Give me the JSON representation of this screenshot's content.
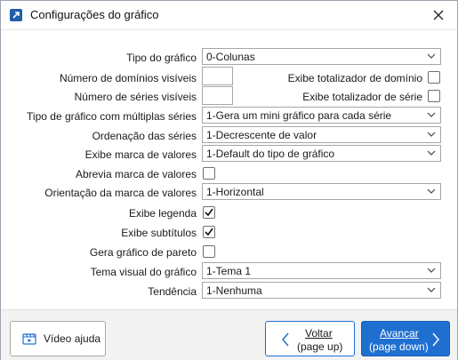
{
  "window": {
    "title": "Configurações do gráfico",
    "app_icon": "chart-arrow-icon",
    "close_icon": "close-icon"
  },
  "form": {
    "tipo_grafico": {
      "label": "Tipo do gráfico",
      "value": "0-Colunas"
    },
    "num_dominios": {
      "label": "Número de domínios visíveis",
      "value": ""
    },
    "totalizador_dominio": {
      "label": "Exibe totalizador de domínio",
      "checked": false
    },
    "num_series": {
      "label": "Número de séries visíveis",
      "value": ""
    },
    "totalizador_serie": {
      "label": "Exibe totalizador de série",
      "checked": false
    },
    "multiplas_series": {
      "label": "Tipo de gráfico com múltiplas séries",
      "value": "1-Gera um mini gráfico para cada série"
    },
    "ordenacao": {
      "label": "Ordenação das séries",
      "value": "1-Decrescente de valor"
    },
    "marca_valores": {
      "label": "Exibe marca de valores",
      "value": "1-Default do tipo de gráfico"
    },
    "abrevia": {
      "label": "Abrevia marca de valores",
      "checked": false
    },
    "orientacao": {
      "label": "Orientação da marca de valores",
      "value": "1-Horizontal"
    },
    "legenda": {
      "label": "Exibe legenda",
      "checked": true
    },
    "subtitulos": {
      "label": "Exibe subtítulos",
      "checked": true
    },
    "pareto": {
      "label": "Gera gráfico de pareto",
      "checked": false
    },
    "tema": {
      "label": "Tema visual do gráfico",
      "value": "1-Tema 1"
    },
    "tendencia": {
      "label": "Tendência",
      "value": "1-Nenhuma"
    }
  },
  "footer": {
    "video_label": "Vídeo ajuda",
    "back_label": "Voltar",
    "back_hint": "(page up)",
    "next_label": "Avançar",
    "next_hint": "(page down)"
  },
  "colors": {
    "accent": "#1f6fd0",
    "footer_bg": "#f3f3f3"
  }
}
